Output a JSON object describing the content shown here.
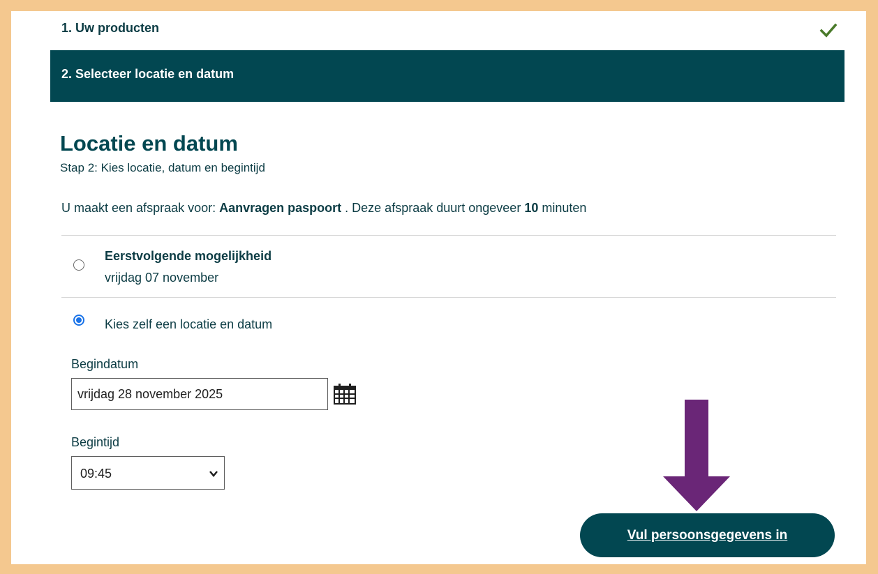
{
  "steps": {
    "step1": {
      "label": "1. Uw producten",
      "status_icon": "check-icon"
    },
    "step2": {
      "label": "2. Selecteer locatie en datum"
    }
  },
  "main": {
    "title": "Locatie en datum",
    "subtitle": "Stap 2: Kies locatie, datum en begintijd",
    "intro": {
      "prefix": "U maakt een afspraak voor: ",
      "product": "Aanvragen paspoort",
      "middle": " . Deze afspraak duurt ongeveer ",
      "duration": "10",
      "suffix": " minuten"
    },
    "options": [
      {
        "title": "Eerstvolgende mogelijkheid",
        "subtitle": "vrijdag 07 november",
        "selected": false
      },
      {
        "title": "Kies zelf een locatie en datum",
        "selected": true
      }
    ],
    "start_date": {
      "label": "Begindatum",
      "value": "vrijdag 28 november 2025"
    },
    "start_time": {
      "label": "Begintijd",
      "value": "09:45"
    }
  },
  "cta": {
    "label": "Vul persoonsgegevens in"
  },
  "colors": {
    "frame": "#f4c88f",
    "brand": "#024751",
    "check": "#4a7a2a",
    "arrow": "#6a2677",
    "radio_selected": "#1a73e8"
  }
}
